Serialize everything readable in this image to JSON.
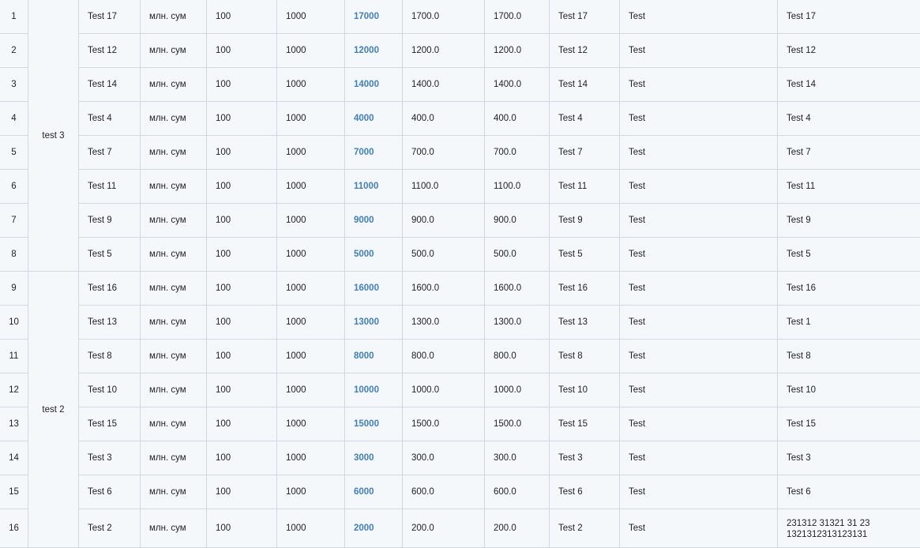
{
  "groups": [
    {
      "name": "test 3",
      "rows": [
        {
          "n": "1",
          "name": "Test 17",
          "unit": "млн. сум",
          "a": "100",
          "b": "1000",
          "total": "17000",
          "c": "1700.0",
          "d": "1700.0",
          "e": "Test 17",
          "f": "Test",
          "g": "Test 17"
        },
        {
          "n": "2",
          "name": "Test 12",
          "unit": "млн. сум",
          "a": "100",
          "b": "1000",
          "total": "12000",
          "c": "1200.0",
          "d": "1200.0",
          "e": "Test 12",
          "f": "Test",
          "g": "Test 12"
        },
        {
          "n": "3",
          "name": "Test 14",
          "unit": "млн. сум",
          "a": "100",
          "b": "1000",
          "total": "14000",
          "c": "1400.0",
          "d": "1400.0",
          "e": "Test 14",
          "f": "Test",
          "g": "Test 14"
        },
        {
          "n": "4",
          "name": "Test 4",
          "unit": "млн. сум",
          "a": "100",
          "b": "1000",
          "total": "4000",
          "c": "400.0",
          "d": "400.0",
          "e": "Test 4",
          "f": "Test",
          "g": "Test 4"
        },
        {
          "n": "5",
          "name": "Test 7",
          "unit": "млн. сум",
          "a": "100",
          "b": "1000",
          "total": "7000",
          "c": "700.0",
          "d": "700.0",
          "e": "Test 7",
          "f": "Test",
          "g": "Test 7"
        },
        {
          "n": "6",
          "name": "Test 11",
          "unit": "млн. сум",
          "a": "100",
          "b": "1000",
          "total": "11000",
          "c": "1100.0",
          "d": "1100.0",
          "e": "Test 11",
          "f": "Test",
          "g": "Test 11"
        },
        {
          "n": "7",
          "name": "Test 9",
          "unit": "млн. сум",
          "a": "100",
          "b": "1000",
          "total": "9000",
          "c": "900.0",
          "d": "900.0",
          "e": "Test 9",
          "f": "Test",
          "g": "Test 9"
        },
        {
          "n": "8",
          "name": "Test 5",
          "unit": "млн. сум",
          "a": "100",
          "b": "1000",
          "total": "5000",
          "c": "500.0",
          "d": "500.0",
          "e": "Test 5",
          "f": "Test",
          "g": "Test 5"
        }
      ]
    },
    {
      "name": "test 2",
      "rows": [
        {
          "n": "9",
          "name": "Test 16",
          "unit": "млн. сум",
          "a": "100",
          "b": "1000",
          "total": "16000",
          "c": "1600.0",
          "d": "1600.0",
          "e": "Test 16",
          "f": "Test",
          "g": "Test 16"
        },
        {
          "n": "10",
          "name": "Test 13",
          "unit": "млн. сум",
          "a": "100",
          "b": "1000",
          "total": "13000",
          "c": "1300.0",
          "d": "1300.0",
          "e": "Test 13",
          "f": "Test",
          "g": "Test 1"
        },
        {
          "n": "11",
          "name": "Test 8",
          "unit": "млн. сум",
          "a": "100",
          "b": "1000",
          "total": "8000",
          "c": "800.0",
          "d": "800.0",
          "e": "Test 8",
          "f": "Test",
          "g": "Test 8"
        },
        {
          "n": "12",
          "name": "Test 10",
          "unit": "млн. сум",
          "a": "100",
          "b": "1000",
          "total": "10000",
          "c": "1000.0",
          "d": "1000.0",
          "e": "Test 10",
          "f": "Test",
          "g": "Test 10"
        },
        {
          "n": "13",
          "name": "Test 15",
          "unit": "млн. сум",
          "a": "100",
          "b": "1000",
          "total": "15000",
          "c": "1500.0",
          "d": "1500.0",
          "e": "Test 15",
          "f": "Test",
          "g": "Test 15"
        },
        {
          "n": "14",
          "name": "Test 3",
          "unit": "млн. сум",
          "a": "100",
          "b": "1000",
          "total": "3000",
          "c": "300.0",
          "d": "300.0",
          "e": "Test 3",
          "f": "Test",
          "g": "Test 3"
        },
        {
          "n": "15",
          "name": "Test 6",
          "unit": "млн. сум",
          "a": "100",
          "b": "1000",
          "total": "6000",
          "c": "600.0",
          "d": "600.0",
          "e": "Test 6",
          "f": "Test",
          "g": "Test 6"
        },
        {
          "n": "16",
          "name": "Test 2",
          "unit": "млн. сум",
          "a": "100",
          "b": "1000",
          "total": "2000",
          "c": "200.0",
          "d": "200.0",
          "e": "Test 2",
          "f": "Test",
          "g": "231312 31321 31 23 1321312313123131"
        }
      ]
    }
  ],
  "colors": {
    "background": "#f5f8fb",
    "border": "#cfd9e3",
    "link": "#3f7fc7",
    "text": "#222222"
  }
}
